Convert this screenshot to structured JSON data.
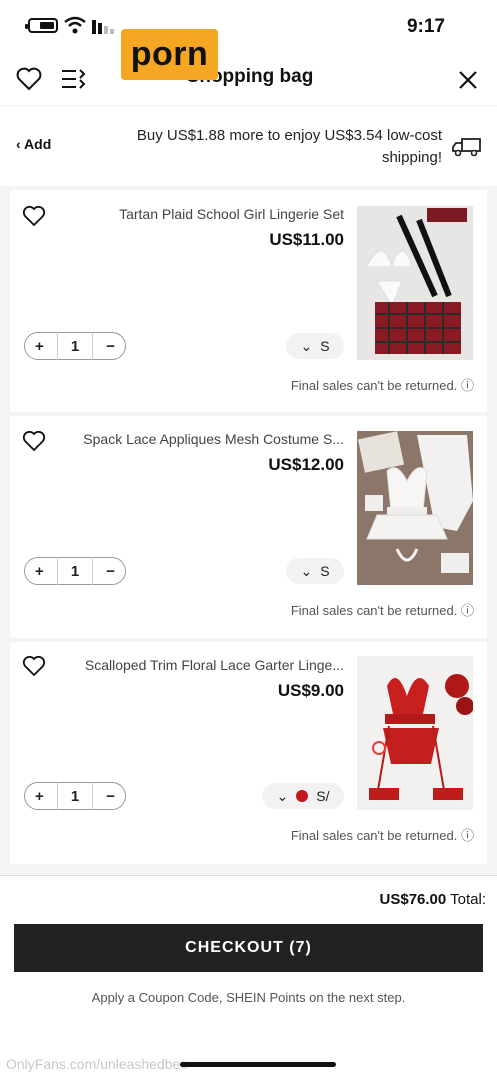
{
  "status_bar": {
    "time": "9:17"
  },
  "overlay_logo": "porn",
  "header": {
    "title": "Shopping bag"
  },
  "shipping_banner": {
    "text": "Buy US$1.88 more to enjoy US$3.54 low-cost shipping!",
    "action": "Add"
  },
  "items": [
    {
      "title": "Tartan Plaid School Girl Lingerie Set",
      "price": "US$11.00",
      "size": "S",
      "qty": "1",
      "note": "Final sales can't be returned."
    },
    {
      "title": "Spack Lace Appliques Mesh Costume S...",
      "price": "US$12.00",
      "size": "S",
      "qty": "1",
      "note": "Final sales can't be returned."
    },
    {
      "title": "Scalloped Trim Floral Lace Garter Linge...",
      "price": "US$9.00",
      "size": "S/",
      "qty": "1",
      "note": "Final sales can't be returned."
    }
  ],
  "footer": {
    "total_label": "Total:",
    "total_value": "US$76.00",
    "checkout_label": "CHECKOUT (7)",
    "coupon_text": "Apply a Coupon Code, SHEIN Points on the next step."
  },
  "watermark": "OnlyFans.com/unleashedbee",
  "colors": {
    "accent": "#f5a623",
    "checkout_bg": "#222222",
    "swatch_red": "#c0181c"
  },
  "icons": {
    "battery": "battery-icon",
    "wifi": "wifi-icon",
    "signal": "signal-icon",
    "close": "close-icon",
    "filter": "filter-list-icon",
    "wishlist": "heart-icon",
    "truck": "truck-icon"
  }
}
